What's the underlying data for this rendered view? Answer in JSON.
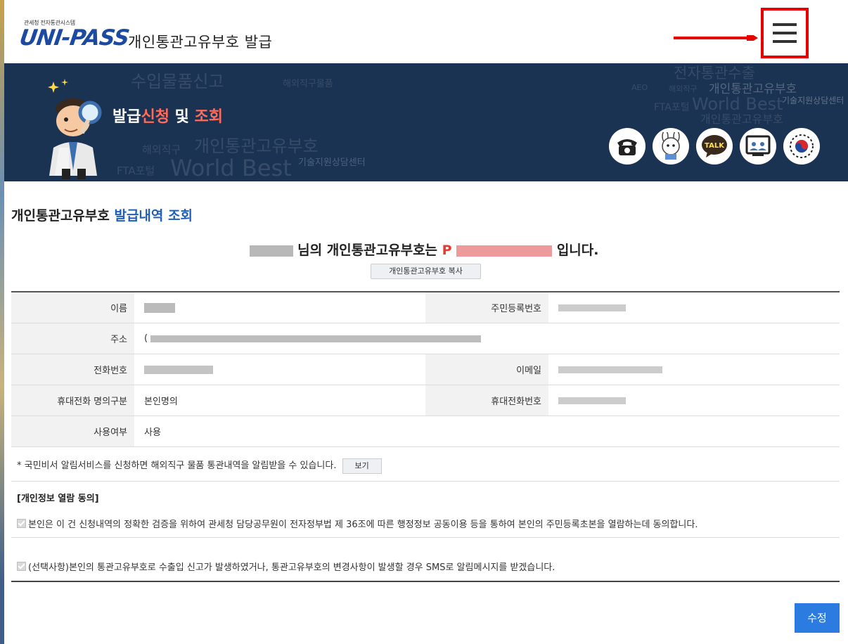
{
  "header": {
    "logo_small": "관세청 전자통관시스템",
    "logo_main": "UNI-PASS",
    "title": "개인통관고유부호 발급"
  },
  "banner": {
    "title_part1": "발급",
    "title_part2": "신청",
    "title_part3": " 및 ",
    "title_part4": "조회",
    "talk_label": "TALK",
    "wordcloud": [
      "수입물품신고",
      "해외직구물품",
      "전자통관수출",
      "개인통관고유부호",
      "AEO",
      "해외직구",
      "FTA포털",
      "World Best",
      "기술지원상담센터",
      "개인통관고유부호",
      "World Best",
      "FTA포털",
      "기술지원상담센터",
      "개인통관고유부호",
      "해외직구"
    ]
  },
  "section": {
    "title_part1": "개인통관고유부호 ",
    "title_part2": "발급내역 조회"
  },
  "result": {
    "suffix1": " 님의 개인통관고유부호는 ",
    "code_prefix": "P",
    "suffix2": " 입니다.",
    "copy_label": "개인통관고유부호 복사"
  },
  "table": {
    "name_label": "이름",
    "rrn_label": "주민등록번호",
    "address_label": "주소",
    "address_prefix": "(",
    "phone_label": "전화번호",
    "email_label": "이메일",
    "mobile_type_label": "휴대전화 명의구분",
    "mobile_type_value": "본인명의",
    "mobile_label": "휴대전화번호",
    "usage_label": "사용여부",
    "usage_value": "사용"
  },
  "note": {
    "text": "* 국민비서 알림서비스를 신청하면 해외직구 물품 통관내역을 알림받을 수 있습니다.",
    "view_label": "보기"
  },
  "consent": {
    "title": "[개인정보 열람 동의]",
    "item1": "본인은 이 건 신청내역의 정확한 검증을 위하여 관세청 담당공무원이 전자정부법 제 36조에 따른 행정정보 공동이용 등을 통하여 본인의 주민등록초본을 열람하는데 동의합니다.",
    "item2": "(선택사항)본인의 통관고유부호로 수출입 신고가 발생하였거나, 통관고유부호의 변경사항이 발생할 경우 SMS로 알림메시지를 받겠습니다."
  },
  "actions": {
    "edit_label": "수정"
  }
}
